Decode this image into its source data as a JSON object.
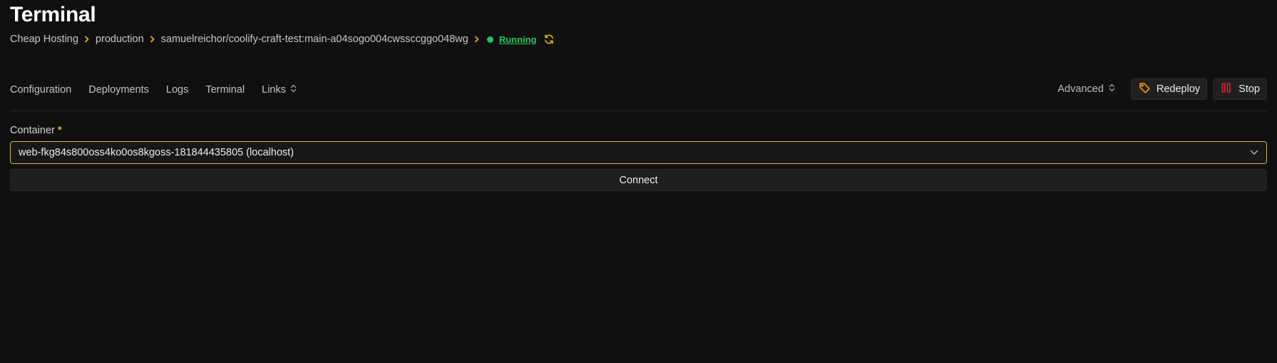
{
  "page": {
    "title": "Terminal"
  },
  "breadcrumb": {
    "items": [
      "Cheap Hosting",
      "production",
      "samuelreichor/coolify-craft-test:main-a04sogo004cwssccggo048wg"
    ],
    "status": "Running"
  },
  "tabs": [
    "Configuration",
    "Deployments",
    "Logs",
    "Terminal",
    "Links"
  ],
  "actions": {
    "advanced": "Advanced",
    "redeploy": "Redeploy",
    "stop": "Stop"
  },
  "form": {
    "container_label": "Container",
    "required_mark": "*",
    "container_value": "web-fkg84s800oss4ko0os8kgoss-181844435805 (localhost)",
    "connect_label": "Connect"
  },
  "colors": {
    "background": "#101010",
    "accent_yellow": "#eab308",
    "status_green": "#22c55e",
    "stop_red": "#dc2626",
    "redeploy_orange": "#f59e0b",
    "select_border": "#d9b346"
  },
  "icons": {
    "breadcrumb_separator": "chevron-right-icon",
    "status": "status-dot-icon",
    "refresh": "refresh-icon",
    "links": "updown-chevron-icon",
    "advanced": "updown-chevron-icon",
    "redeploy": "tag-icon",
    "stop": "pause-icon",
    "select": "chevron-down-icon"
  }
}
